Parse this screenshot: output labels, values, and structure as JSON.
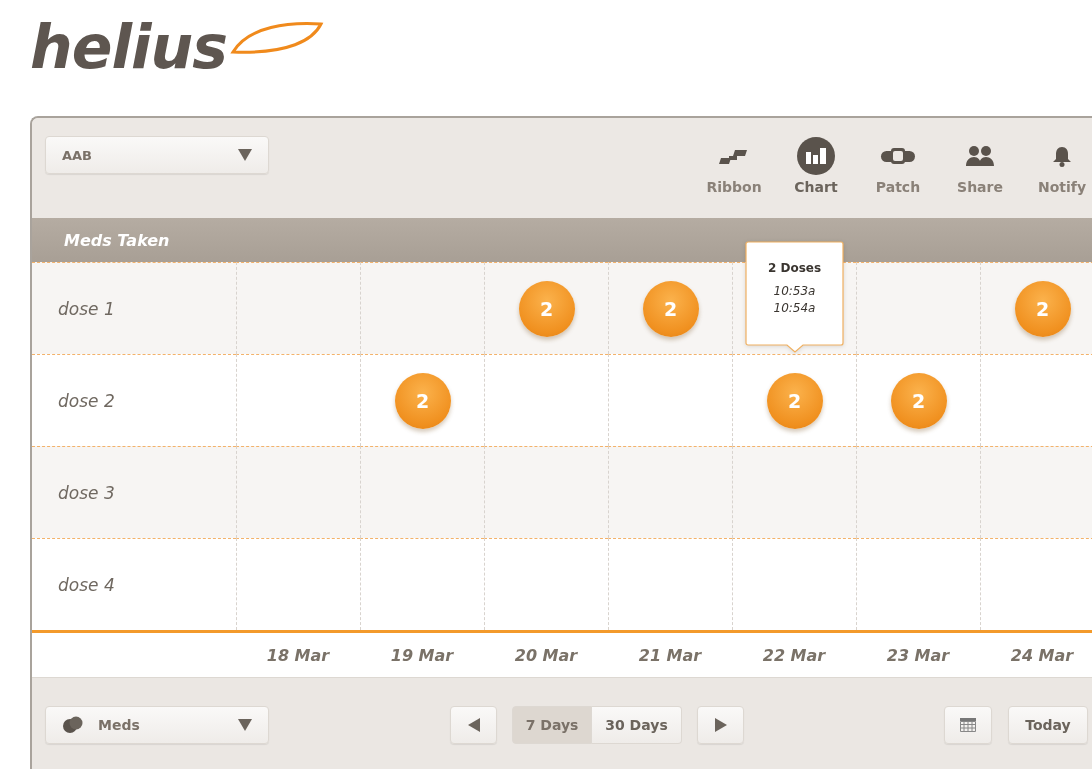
{
  "logo": {
    "text": "helius"
  },
  "toolbar": {
    "select": {
      "value": "AAB"
    },
    "views": [
      {
        "kind": "ribbon",
        "label": "Ribbon",
        "selected": false
      },
      {
        "kind": "chart",
        "label": "Chart",
        "selected": true
      },
      {
        "kind": "patch",
        "label": "Patch",
        "selected": false
      },
      {
        "kind": "share",
        "label": "Share",
        "selected": false
      },
      {
        "kind": "notify",
        "label": "Notify",
        "selected": false
      }
    ]
  },
  "section_title": "Meds Taken",
  "rows": [
    {
      "label": "dose 1",
      "cells": [
        {
          "marker": false
        },
        {
          "marker": false
        },
        {
          "marker": true,
          "count": "2"
        },
        {
          "marker": true,
          "count": "2"
        },
        {
          "marker": false,
          "tooltip": {
            "title": "2 Doses",
            "times": [
              "10:53a",
              "10:54a"
            ]
          }
        },
        {
          "marker": false
        },
        {
          "marker": true,
          "count": "2"
        }
      ]
    },
    {
      "label": "dose 2",
      "cells": [
        {
          "marker": false
        },
        {
          "marker": true,
          "count": "2"
        },
        {
          "marker": false
        },
        {
          "marker": false
        },
        {
          "marker": true,
          "count": "2"
        },
        {
          "marker": true,
          "count": "2"
        },
        {
          "marker": false
        }
      ]
    },
    {
      "label": "dose 3",
      "cells": [
        {
          "marker": false
        },
        {
          "marker": false
        },
        {
          "marker": false
        },
        {
          "marker": false
        },
        {
          "marker": false
        },
        {
          "marker": false
        },
        {
          "marker": false
        }
      ]
    },
    {
      "label": "dose 4",
      "cells": [
        {
          "marker": false
        },
        {
          "marker": false
        },
        {
          "marker": false
        },
        {
          "marker": false
        },
        {
          "marker": false
        },
        {
          "marker": false
        },
        {
          "marker": false
        }
      ]
    }
  ],
  "dates": [
    "18 Mar",
    "19 Mar",
    "20 Mar",
    "21 Mar",
    "22 Mar",
    "23 Mar",
    "24 Mar"
  ],
  "footer": {
    "select": {
      "value": "Meds"
    },
    "ranges": [
      {
        "label": "7 Days",
        "selected": true
      },
      {
        "label": "30 Days",
        "selected": false
      }
    ],
    "today": "Today"
  }
}
